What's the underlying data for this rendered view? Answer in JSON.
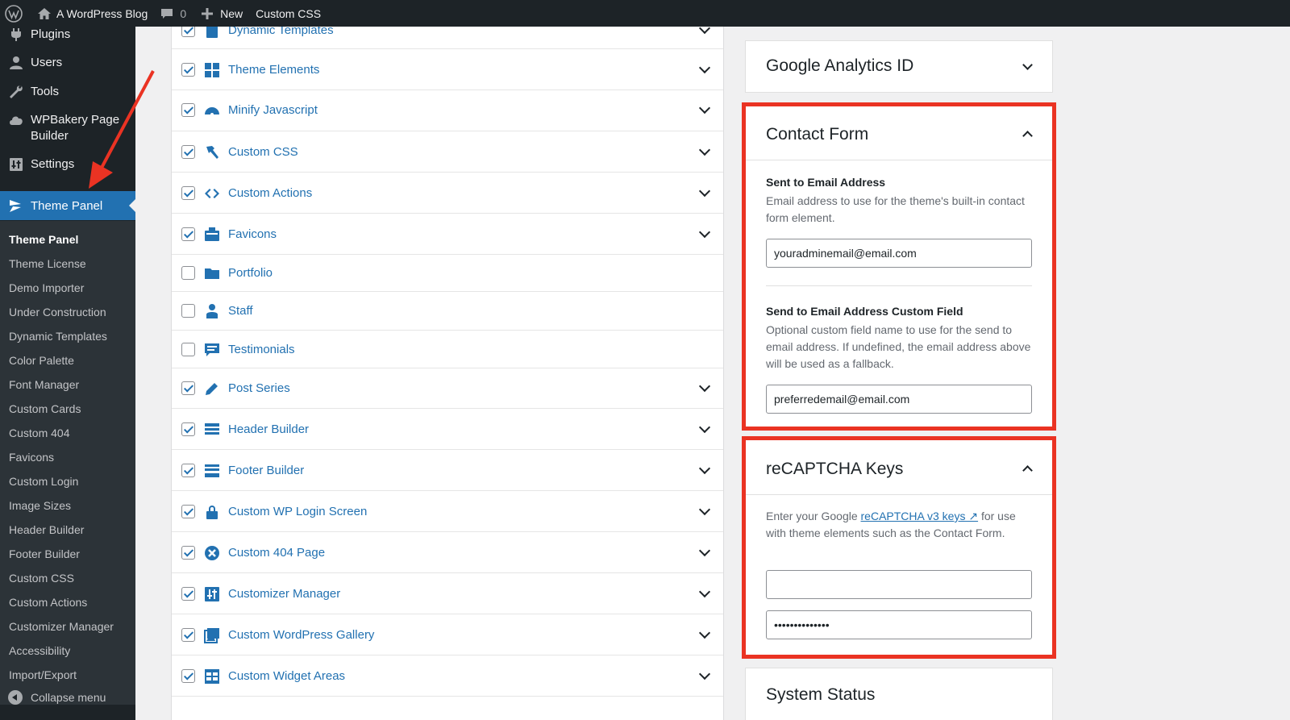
{
  "admin_bar": {
    "site_name": "A WordPress Blog",
    "comments_count": "0",
    "new_label": "New",
    "custom_css_label": "Custom CSS"
  },
  "sidebar": {
    "top_items": [
      {
        "label": "Plugins",
        "icon": "plugin-icon"
      },
      {
        "label": "Users",
        "icon": "users-icon"
      },
      {
        "label": "Tools",
        "icon": "wrench-icon"
      },
      {
        "label": "WPBakery Page Builder",
        "icon": "cloud-icon"
      },
      {
        "label": "Settings",
        "icon": "settings-icon"
      }
    ],
    "active_item": {
      "label": "Theme Panel",
      "icon": "theme-panel-icon"
    },
    "submenu": [
      "Theme Panel",
      "Theme License",
      "Demo Importer",
      "Under Construction",
      "Dynamic Templates",
      "Color Palette",
      "Font Manager",
      "Custom Cards",
      "Custom 404",
      "Favicons",
      "Custom Login",
      "Image Sizes",
      "Header Builder",
      "Footer Builder",
      "Custom CSS",
      "Custom Actions",
      "Customizer Manager",
      "Accessibility",
      "Import/Export"
    ],
    "collapse_label": "Collapse menu"
  },
  "modules": [
    {
      "name": "Dynamic Templates",
      "checked": true,
      "icon": "template-icon",
      "expandable": true
    },
    {
      "name": "Theme Elements",
      "checked": true,
      "icon": "grid-icon",
      "expandable": true
    },
    {
      "name": "Minify Javascript",
      "checked": true,
      "icon": "dashboard-icon",
      "expandable": true
    },
    {
      "name": "Custom CSS",
      "checked": true,
      "icon": "hammer-icon",
      "expandable": true
    },
    {
      "name": "Custom Actions",
      "checked": true,
      "icon": "code-icon",
      "expandable": true
    },
    {
      "name": "Favicons",
      "checked": true,
      "icon": "favicon-icon",
      "expandable": true
    },
    {
      "name": "Portfolio",
      "checked": false,
      "icon": "folder-icon",
      "expandable": false
    },
    {
      "name": "Staff",
      "checked": false,
      "icon": "staff-icon",
      "expandable": false
    },
    {
      "name": "Testimonials",
      "checked": false,
      "icon": "testimonial-icon",
      "expandable": false
    },
    {
      "name": "Post Series",
      "checked": true,
      "icon": "pencil-icon",
      "expandable": true
    },
    {
      "name": "Header Builder",
      "checked": true,
      "icon": "header-icon",
      "expandable": true
    },
    {
      "name": "Footer Builder",
      "checked": true,
      "icon": "footer-icon",
      "expandable": true
    },
    {
      "name": "Custom WP Login Screen",
      "checked": true,
      "icon": "lock-icon",
      "expandable": true
    },
    {
      "name": "Custom 404 Page",
      "checked": true,
      "icon": "error-icon",
      "expandable": true
    },
    {
      "name": "Customizer Manager",
      "checked": true,
      "icon": "customizer-icon",
      "expandable": true
    },
    {
      "name": "Custom WordPress Gallery",
      "checked": true,
      "icon": "gallery-icon",
      "expandable": true
    },
    {
      "name": "Custom Widget Areas",
      "checked": true,
      "icon": "widgets-icon",
      "expandable": true
    }
  ],
  "panels": {
    "google_analytics": {
      "title": "Google Analytics ID"
    },
    "contact_form": {
      "title": "Contact Form",
      "field1_label": "Sent to Email Address",
      "field1_desc": "Email address to use for the theme's built-in contact form element.",
      "field1_value": "youradminemail@email.com",
      "field2_label": "Send to Email Address Custom Field",
      "field2_desc": "Optional custom field name to use for the send to email address. If undefined, the email address above will be used as a fallback.",
      "field2_value": "preferredemail@email.com"
    },
    "recaptcha": {
      "title": "reCAPTCHA Keys",
      "desc_prefix": "Enter your Google ",
      "desc_link": "reCAPTCHA v3 keys ↗",
      "desc_suffix": " for use with theme elements such as the Contact Form.",
      "site_key_value": "",
      "secret_key_value": "••••••••••••••"
    },
    "system_status": {
      "title": "System Status"
    }
  },
  "colors": {
    "admin_dark": "#1d2327",
    "accent_blue": "#2271b1",
    "highlight_red": "#ea3323"
  }
}
